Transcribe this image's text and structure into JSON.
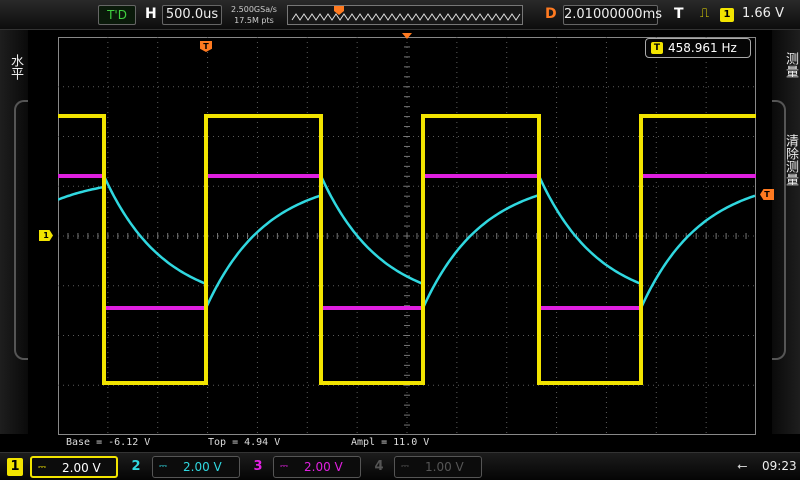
{
  "header": {
    "trigger_status": "T'D",
    "horizontal_label": "H",
    "timebase": "500.0us",
    "sample_rate": "2.500GSa/s",
    "memory_depth": "17.5M pts",
    "delay_label": "D",
    "delay": "2.01000000ms",
    "trigger_label": "T",
    "trigger_source": "1",
    "trigger_level": "1.66 V",
    "trigger_edge_icon": "rising-edge-icon"
  },
  "left_menu": {
    "label": "水平"
  },
  "right_menu": {
    "measure": "测量",
    "clear_measure": "清除测量"
  },
  "markers": {
    "trigger_position": "T",
    "ch1_ground": "1",
    "trigger_level": "T"
  },
  "frequency": {
    "source": "T",
    "value": "458.961 Hz"
  },
  "measurements": {
    "base": "Base = -6.12 V",
    "top": "Top = 4.94 V",
    "ampl": "Ampl = 11.0 V"
  },
  "channels": [
    {
      "num": "1",
      "coupling": "⎓",
      "vdiv": "2.00 V",
      "color": "#f2e400",
      "active": true
    },
    {
      "num": "2",
      "coupling": "⎓",
      "vdiv": "2.00 V",
      "color": "#30d8e0",
      "active": true
    },
    {
      "num": "3",
      "coupling": "⎓",
      "vdiv": "2.00 V",
      "color": "#e020e0",
      "active": true
    },
    {
      "num": "4",
      "coupling": "⎓",
      "vdiv": "1.00 V",
      "color": "#555555",
      "active": false
    }
  ],
  "status": {
    "usb_icon": "usb-icon",
    "clock": "09:23"
  },
  "colors": {
    "ch1": "#f2e400",
    "ch2": "#30d8e0",
    "ch3": "#e020e0",
    "trigger": "#ff7a20",
    "grid": "#5a5a5a"
  }
}
